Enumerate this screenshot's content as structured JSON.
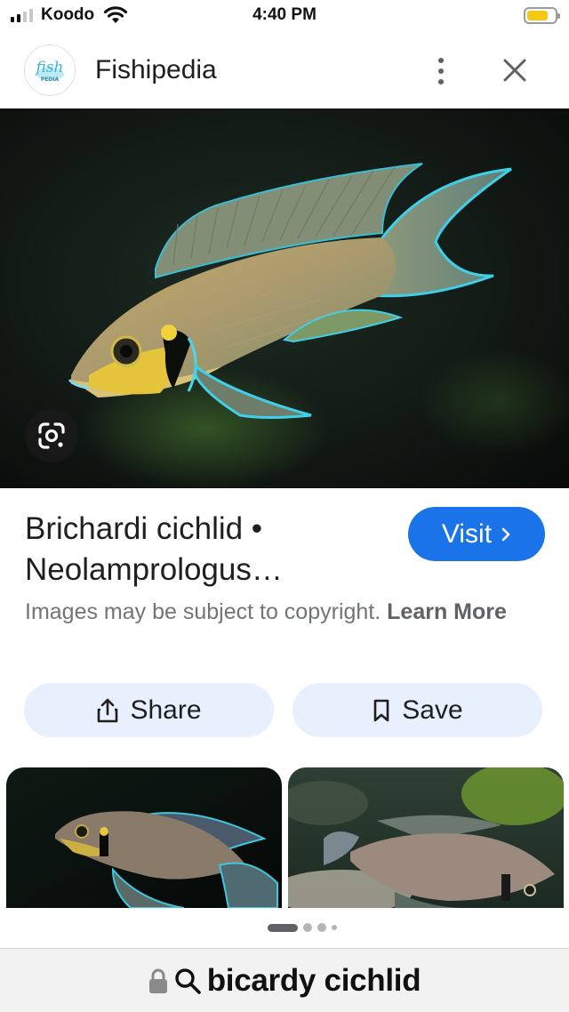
{
  "status_bar": {
    "carrier": "Koodo",
    "time": "4:40 PM",
    "signal_bars": 4,
    "signal_active": 2,
    "battery_level": 0.78,
    "battery_color": "#f6c915"
  },
  "header": {
    "site_name": "Fishipedia",
    "logo_text": "fish",
    "logo_subtext": "PEDIA",
    "more_icon": "more-vert-icon",
    "close_icon": "close-icon"
  },
  "main_image": {
    "subject": "fish photo",
    "lens_icon": "google-lens-icon"
  },
  "result": {
    "title": "Brichardi cichlid • Neolamprologus…",
    "visit_label": "Visit",
    "copyright_text": "Images may be subject to copyright.",
    "learn_more": "Learn More"
  },
  "actions": {
    "share_label": "Share",
    "save_label": "Save"
  },
  "pager": {
    "pages": 4,
    "current": 1
  },
  "url_bar": {
    "query": "bicardy cichlid",
    "lock_icon": "lock-icon",
    "search_icon": "search-icon"
  },
  "colors": {
    "accent": "#1a73e8",
    "action_bg": "#e8f0fe"
  }
}
